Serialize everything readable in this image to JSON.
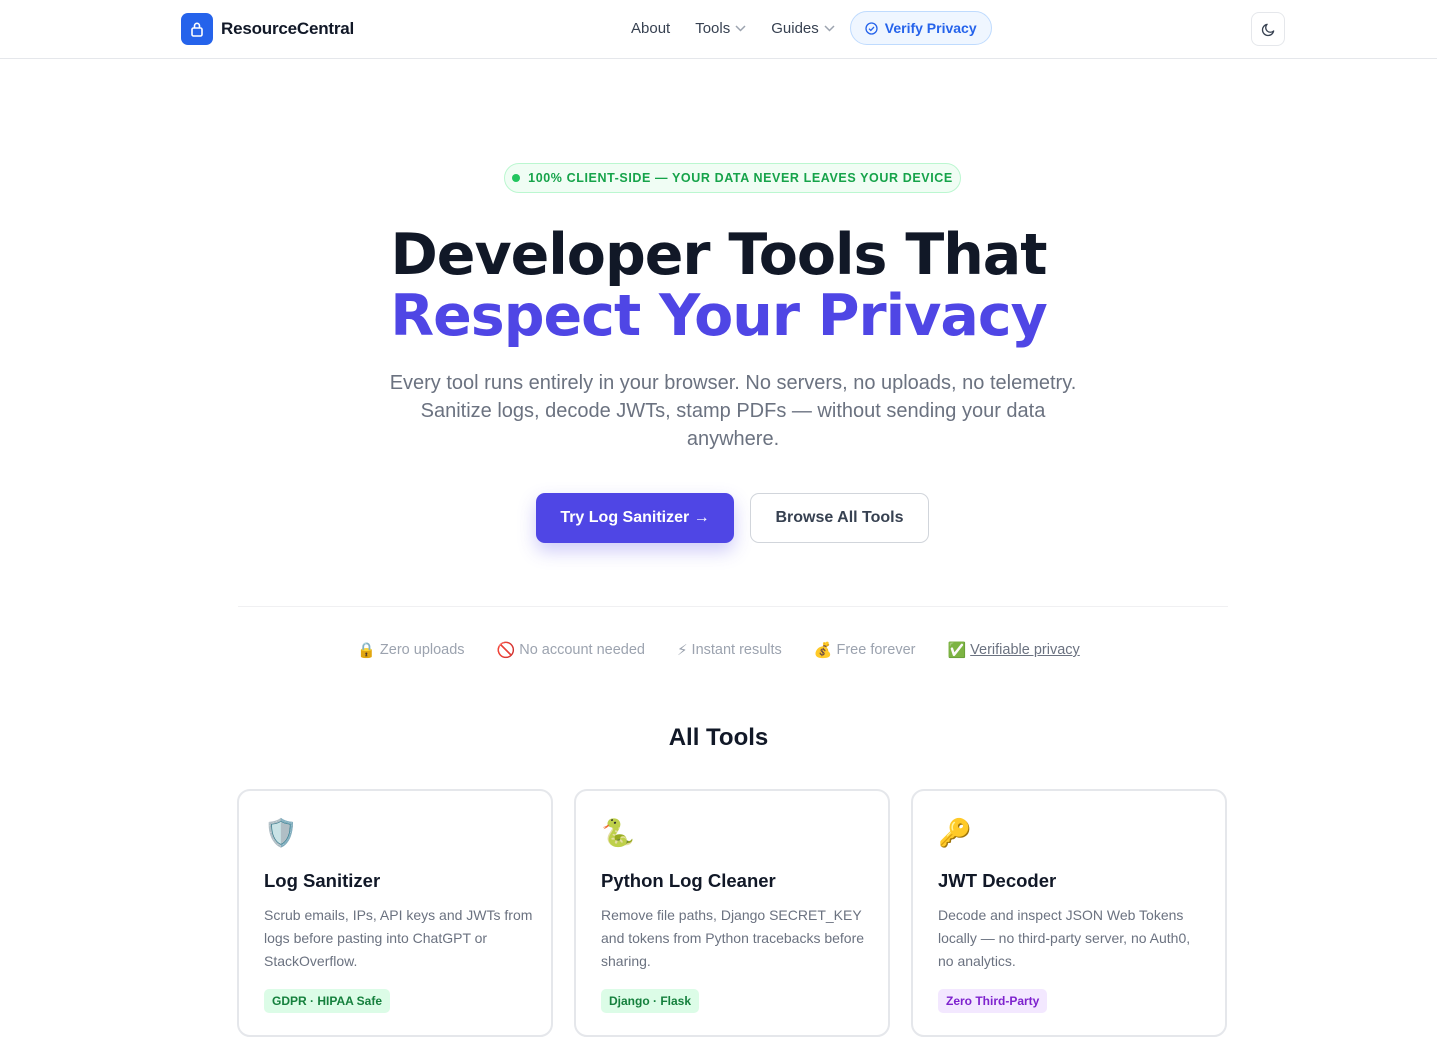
{
  "header": {
    "brand_name": "ResourceCentral",
    "brand_icon": "lock-icon",
    "nav": {
      "about": "About",
      "tools": "Tools",
      "guides": "Guides",
      "verify": "Verify Privacy"
    },
    "theme_icon": "moon-icon"
  },
  "hero": {
    "badge": "100% CLIENT-SIDE — YOUR DATA NEVER LEAVES YOUR DEVICE",
    "title_line1": "Developer Tools That",
    "title_line2": "Respect Your Privacy",
    "subtitle": "Every tool runs entirely in your browser. No servers, no uploads, no telemetry. Sanitize logs, decode JWTs, stamp PDFs — without sending your data anywhere.",
    "primary_button": "Try Log Sanitizer →",
    "secondary_button": "Browse All Tools"
  },
  "features": [
    {
      "emoji": "🔒",
      "label": "Zero uploads"
    },
    {
      "emoji": "🚫",
      "label": "No account needed"
    },
    {
      "emoji": "⚡",
      "label": "Instant results"
    },
    {
      "emoji": "💰",
      "label": "Free forever"
    },
    {
      "emoji": "✅",
      "label": "Verifiable privacy"
    }
  ],
  "tools_section": {
    "title": "All Tools",
    "cards": [
      {
        "emoji": "🛡️",
        "title": "Log Sanitizer",
        "description": "Scrub emails, IPs, API keys and JWTs from logs before pasting into ChatGPT or StackOverflow.",
        "tag": "GDPR · HIPAA Safe"
      },
      {
        "emoji": "🐍",
        "title": "Python Log Cleaner",
        "description": "Remove file paths, Django SECRET_KEY and tokens from Python tracebacks before sharing.",
        "tag": "Django · Flask"
      },
      {
        "emoji": "🔑",
        "title": "JWT Decoder",
        "description": "Decode and inspect JSON Web Tokens locally — no third-party server, no Auth0, no analytics.",
        "tag": "Zero Third-Party"
      }
    ]
  },
  "colors": {
    "brand_blue": "#2563eb",
    "accent_indigo": "#4f46e5",
    "success_green": "#16a34a",
    "tag_purple": "#7e22ce"
  }
}
